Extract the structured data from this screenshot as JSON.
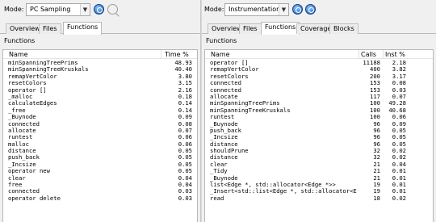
{
  "left": {
    "mode_label": "Mode:",
    "mode_value": "PC Sampling",
    "tabs": [
      {
        "label": "Overview",
        "active": false
      },
      {
        "label": "Files",
        "active": false
      },
      {
        "label": "Functions",
        "active": true
      }
    ],
    "section_title": "Functions",
    "columns": [
      "Name",
      "Time %"
    ],
    "rows": [
      {
        "name": "minSpanningTreePrims",
        "time": "48.93"
      },
      {
        "name": "minSpanningTreeKruskals",
        "time": "40.40"
      },
      {
        "name": "remapVertColor",
        "time": "3.80"
      },
      {
        "name": "resetColors",
        "time": "3.15"
      },
      {
        "name": "operator []",
        "time": "2.16"
      },
      {
        "name": "_malloc",
        "time": "0.18"
      },
      {
        "name": "calculateEdges",
        "time": "0.14"
      },
      {
        "name": "_free",
        "time": "0.14"
      },
      {
        "name": "_Buynode",
        "time": "0.09"
      },
      {
        "name": "connected",
        "time": "0.08"
      },
      {
        "name": "allocate",
        "time": "0.07"
      },
      {
        "name": "runtest",
        "time": "0.06"
      },
      {
        "name": "malloc",
        "time": "0.06"
      },
      {
        "name": "distance",
        "time": "0.05"
      },
      {
        "name": "push_back",
        "time": "0.05"
      },
      {
        "name": "_Incsize",
        "time": "0.05"
      },
      {
        "name": "operator new",
        "time": "0.05"
      },
      {
        "name": "clear",
        "time": "0.04"
      },
      {
        "name": "free",
        "time": "0.04"
      },
      {
        "name": "connected",
        "time": "0.03"
      },
      {
        "name": "operator delete",
        "time": "0.03"
      }
    ]
  },
  "right": {
    "mode_label": "Mode:",
    "mode_value": "Instrumentation",
    "tabs": [
      {
        "label": "Overview",
        "active": false
      },
      {
        "label": "Files",
        "active": false
      },
      {
        "label": "Functions",
        "active": true
      },
      {
        "label": "Coverage",
        "active": false
      },
      {
        "label": "Blocks",
        "active": false
      }
    ],
    "section_title": "Functions",
    "columns": [
      "Name",
      "Calls",
      "Inst %"
    ],
    "rows": [
      {
        "name": "operator []",
        "calls": "11188",
        "inst": "2.18"
      },
      {
        "name": "remapVertColor",
        "calls": "400",
        "inst": "3.82"
      },
      {
        "name": "resetColors",
        "calls": "200",
        "inst": "3.17"
      },
      {
        "name": "connected",
        "calls": "153",
        "inst": "0.08"
      },
      {
        "name": "connected",
        "calls": "153",
        "inst": "0.03"
      },
      {
        "name": "allocate",
        "calls": "117",
        "inst": "0.07"
      },
      {
        "name": "minSpanningTreePrims",
        "calls": "100",
        "inst": "49.28"
      },
      {
        "name": "minSpanningTreeKruskals",
        "calls": "100",
        "inst": "40.68"
      },
      {
        "name": "runtest",
        "calls": "100",
        "inst": "0.06"
      },
      {
        "name": "_Buynode",
        "calls": "96",
        "inst": "0.09"
      },
      {
        "name": "push_back",
        "calls": "96",
        "inst": "0.05"
      },
      {
        "name": "_Incsize",
        "calls": "96",
        "inst": "0.05"
      },
      {
        "name": "distance",
        "calls": "96",
        "inst": "0.05"
      },
      {
        "name": "shouldPrune",
        "calls": "32",
        "inst": "0.02"
      },
      {
        "name": "distance",
        "calls": "32",
        "inst": "0.02"
      },
      {
        "name": "clear",
        "calls": "21",
        "inst": "0.04"
      },
      {
        "name": "_Tidy",
        "calls": "21",
        "inst": "0.01"
      },
      {
        "name": "_Buynode",
        "calls": "21",
        "inst": "0.01"
      },
      {
        "name": "list<Edge *, std::allocator<Edge *>>",
        "calls": "19",
        "inst": "0.01"
      },
      {
        "name": "_Insert<std::list<Edge *, std::allocator<E",
        "calls": "19",
        "inst": "0.01"
      },
      {
        "name": "read",
        "calls": "18",
        "inst": "0.02"
      }
    ]
  }
}
